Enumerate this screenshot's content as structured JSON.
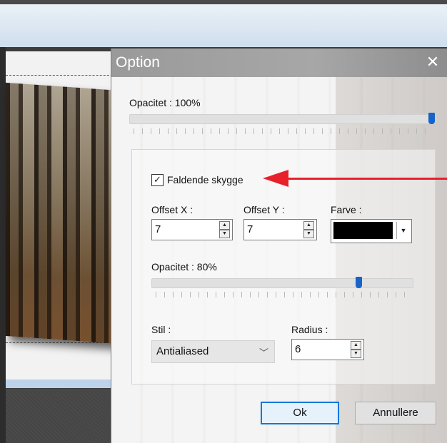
{
  "dialog": {
    "title": "Option",
    "close_glyph": "✕",
    "opacity_label": "Opacitet : 100%",
    "opacity_value": 1.0,
    "shadow": {
      "checkbox_label": "Faldende skygge",
      "checked": true,
      "offset_x_label": "Offset X :",
      "offset_x_value": "7",
      "offset_y_label": "Offset Y :",
      "offset_y_value": "7",
      "color_label": "Farve :",
      "color_value": "#000000",
      "opacity_label": "Opacitet : 80%",
      "opacity_value": 0.8,
      "style_label": "Stil :",
      "style_value": "Antialiased",
      "radius_label": "Radius :",
      "radius_value": "6"
    },
    "ok_label": "Ok",
    "cancel_label": "Annullere"
  },
  "icons": {
    "close": "close-icon",
    "check": "checkmark-icon",
    "spin_up": "arrow-up-icon",
    "spin_down": "arrow-down-icon",
    "dropdown": "chevron-down-icon",
    "annotation": "red-arrow-icon"
  },
  "colors": {
    "slider_thumb": "#1763c9",
    "annotation_arrow": "#e8202a",
    "ok_border": "#0078d7"
  }
}
